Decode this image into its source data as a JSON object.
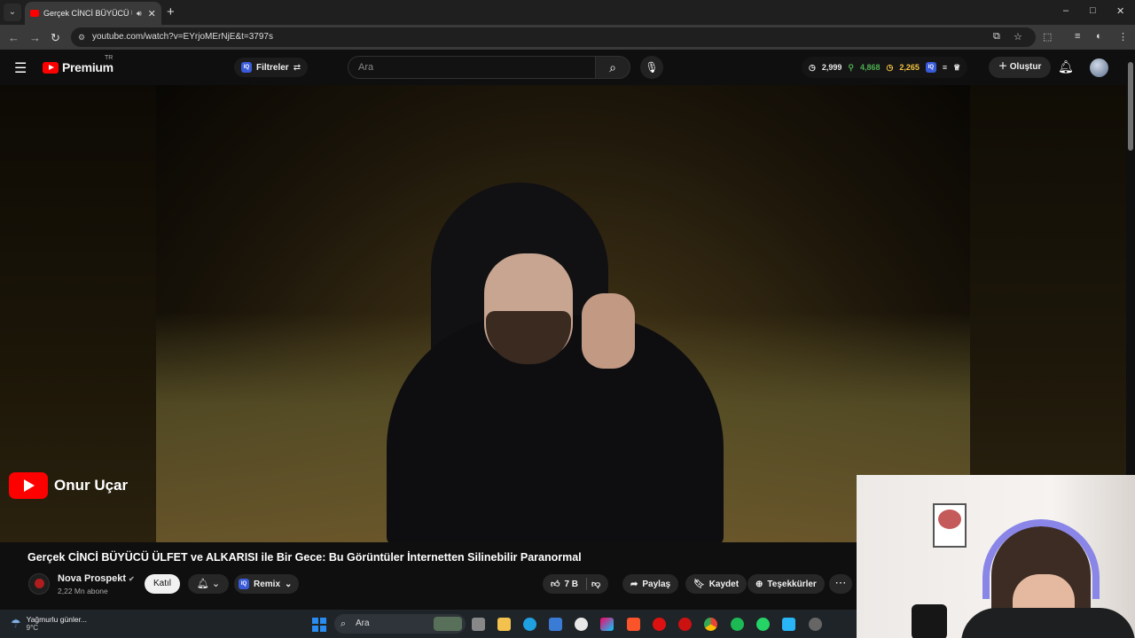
{
  "browser": {
    "tab_title": "Gerçek CİNCİ BÜYÜCÜ ÜLFET ve ALKARISI ile Bir Gece",
    "tab_audio_icon": "speaker-icon",
    "url": "youtube.com/watch?v=EYrjoMErNjE&t=3797s",
    "window_controls": [
      "–",
      "□",
      "✕"
    ]
  },
  "youtube": {
    "logo_text": "Premium",
    "logo_region": "TR",
    "filters_label": "Filtreler",
    "search_placeholder": "Ara",
    "stats": [
      "2,999",
      "4,868",
      "2,265"
    ],
    "create_label": "Oluştur"
  },
  "video": {
    "watermark_channel": "Onur Uçar",
    "title": "Gerçek CİNCİ BÜYÜCÜ ÜLFET ve ALKARISI ile Bir Gece: Bu Görüntüler İnternetten Silinebilir Paranormal"
  },
  "channel": {
    "name": "Nova Prospekt",
    "subscribers": "2,22 Mn abone",
    "join_label": "Katıl",
    "remix_label": "Remix"
  },
  "actions": {
    "likes": "7 B",
    "share": "Paylaş",
    "save": "Kaydet",
    "thanks": "Teşekkürler"
  },
  "taskbar": {
    "weather_text": "Yağmurlu günler...",
    "weather_temp": "9°C",
    "search_placeholder": "Ara"
  },
  "colors": {
    "brand_red": "#ff0000",
    "stat_green": "#4caf50",
    "stat_gold": "#f4c542"
  }
}
